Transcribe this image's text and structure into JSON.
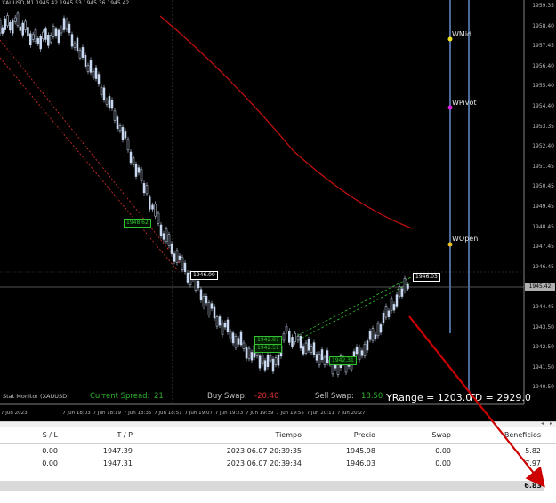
{
  "chart": {
    "symbol_line": "XAUUSD,M1  1945.42 1945.53 1945.36 1945.42",
    "price_axis": [
      "1959.35",
      "1958.40",
      "1957.45",
      "1956.40",
      "1955.40",
      "1954.40",
      "1953.35",
      "1952.40",
      "1951.45",
      "1950.45",
      "1949.45",
      "1948.45",
      "1947.45",
      "1946.45",
      "1945.42",
      "1944.45",
      "1943.50",
      "1942.50",
      "1941.50",
      "1940.50"
    ],
    "current_price": "1945.42",
    "time_axis": [
      "7 Jun 2023",
      "7 Jun 18:03",
      "7 Jun 18:19",
      "7 Jun 18:35",
      "7 Jun 18:51",
      "7 Jun 19:07",
      "7 Jun 19:23",
      "7 Jun 19:39",
      "7 Jun 19:55",
      "7 Jun 20:11",
      "7 Jun 20:27"
    ],
    "pivot_labels": {
      "wmid": "WMid",
      "wpivot": "WPivot",
      "wopen": "WOpen"
    },
    "price_tags": [
      "1948.62",
      "1946.09",
      "1946.03",
      "1942.87",
      "1942.51",
      "1942.31"
    ],
    "colors": {
      "background": "#000000",
      "candle": "#c8d8f0",
      "ma_line": "#c01010",
      "trend": "#e03030",
      "green_label": "#30c030",
      "pivot_line": "#4a6a9a",
      "arrow": "#cc0000"
    }
  },
  "status": {
    "monitor_label": "Stat Monitor (XAUUSD)",
    "spread_label": "Current Spread:",
    "spread_value": "21",
    "buy_swap_label": "Buy Swap:",
    "buy_swap_value": "-20.40",
    "sell_swap_label": "Sell Swap:",
    "sell_swap_value": "18.50",
    "yrange": "YRange = 1203.0",
    "td": "TD = 2929.0"
  },
  "trade_table": {
    "headers": {
      "sl": "S / L",
      "tp": "T / P",
      "time": "Tiempo",
      "price": "Precio",
      "swap": "Swap",
      "profit": "Beneficios"
    },
    "rows": [
      {
        "sl": "0.00",
        "tp": "1947.39",
        "time": "2023.06.07 20:39:35",
        "price": "1945.98",
        "swap": "0.00",
        "profit": "5.82"
      },
      {
        "sl": "0.00",
        "tp": "1947.31",
        "time": "2023.06.07 20:39:34",
        "price": "1946.03",
        "swap": "0.00",
        "profit": "7.97"
      }
    ],
    "total_profit": "6.83"
  }
}
